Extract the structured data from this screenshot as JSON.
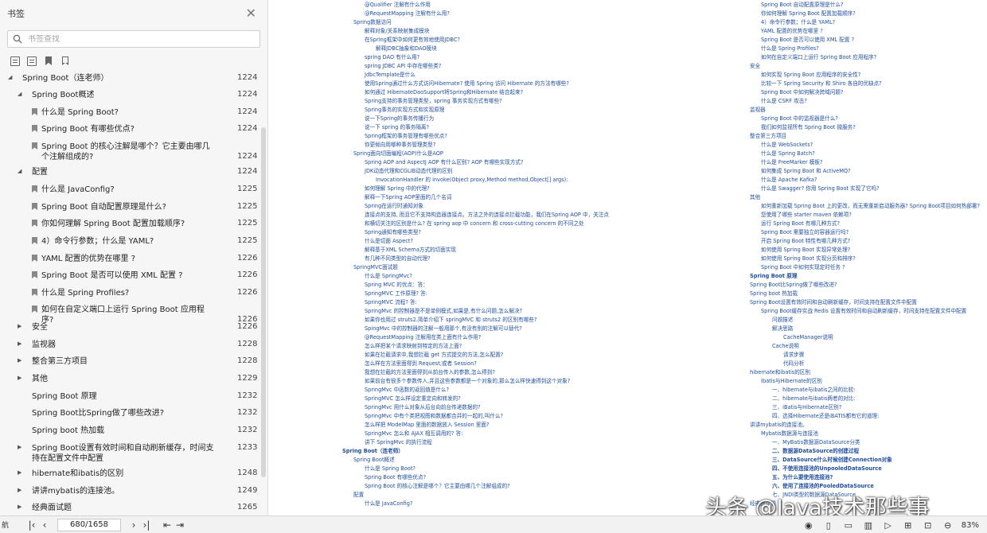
{
  "sidebar": {
    "title": "书签",
    "search_placeholder": "书签查找",
    "items": [
      {
        "label": "Spring Boot（连老师）",
        "page": "1224",
        "level": 0,
        "arrow": "open"
      },
      {
        "label": "Spring Boot概述",
        "page": "1224",
        "level": 1,
        "arrow": "open"
      },
      {
        "label": "什么是 Spring Boot?",
        "page": "1224",
        "level": 2,
        "arrow": "none"
      },
      {
        "label": "Spring Boot 有哪些优点?",
        "page": "1224",
        "level": 2,
        "arrow": "none"
      },
      {
        "label": "Spring Boot 的核心注解是哪个？它主要由哪几个注解组成的?",
        "page": "1224",
        "level": 2,
        "arrow": "none"
      },
      {
        "label": "配置",
        "page": "1224",
        "level": 1,
        "arrow": "open"
      },
      {
        "label": "什么是 JavaConfig?",
        "page": "1225",
        "level": 2,
        "arrow": "none"
      },
      {
        "label": "Spring Boot 自动配置原理是什么?",
        "page": "1225",
        "level": 2,
        "arrow": "none"
      },
      {
        "label": "你如何理解 Spring Boot 配置加载顺序?",
        "page": "1225",
        "level": 2,
        "arrow": "none"
      },
      {
        "label": "4）命令行参数；什么是 YAML?",
        "page": "1225",
        "level": 2,
        "arrow": "none"
      },
      {
        "label": "YAML 配置的优势在哪里 ?",
        "page": "1226",
        "level": 2,
        "arrow": "none"
      },
      {
        "label": "Spring Boot 是否可以使用 XML 配置 ?",
        "page": "1226",
        "level": 2,
        "arrow": "none"
      },
      {
        "label": "什么是 Spring Profiles?",
        "page": "1226",
        "level": 2,
        "arrow": "none"
      },
      {
        "label": "如何在自定义端口上运行 Spring Boot 应用程序?",
        "page": "1226",
        "level": 2,
        "arrow": "none"
      },
      {
        "label": "安全",
        "page": "1226",
        "level": 1,
        "arrow": "closed"
      },
      {
        "label": "监视器",
        "page": "1228",
        "level": 1,
        "arrow": "closed"
      },
      {
        "label": "整合第三方项目",
        "page": "1228",
        "level": 1,
        "arrow": "closed"
      },
      {
        "label": "其他",
        "page": "1229",
        "level": 1,
        "arrow": "closed"
      },
      {
        "label": "Spring Boot 原理",
        "page": "1232",
        "level": 1,
        "arrow": "none"
      },
      {
        "label": "Spring Boot比Spring做了哪些改进?",
        "page": "1232",
        "level": 1,
        "arrow": "none"
      },
      {
        "label": "Spring boot 热加载",
        "page": "1232",
        "level": 1,
        "arrow": "none"
      },
      {
        "label": "Spring Boot设置有效时间和自动刷新缓存，时间支持在配置文件中配置",
        "page": "1233",
        "level": 1,
        "arrow": "closed"
      },
      {
        "label": "hibernate和ibatis的区别",
        "page": "1248",
        "level": 1,
        "arrow": "closed"
      },
      {
        "label": "讲讲mybatis的连接池。",
        "page": "1249",
        "level": 1,
        "arrow": "closed"
      },
      {
        "label": "经典面试题",
        "page": "1265",
        "level": 1,
        "arrow": "closed"
      }
    ]
  },
  "document": {
    "left_column": [
      {
        "t": "@Qualifier 注解有什么作用",
        "lvl": 2,
        "b": false
      },
      {
        "t": "@RequestMapping 注解有什么用?",
        "lvl": 2,
        "b": false
      },
      {
        "t": "Spring数据访问",
        "lvl": 1,
        "b": false
      },
      {
        "t": "解释对象/关系映射集成模块",
        "lvl": 2,
        "b": false
      },
      {
        "t": "在Spring框架中如何更有效地使用JDBC?",
        "lvl": 2,
        "b": false
      },
      {
        "t": "解释JDBC抽象和DAO模块",
        "lvl": 3,
        "b": false
      },
      {
        "t": "spring DAO 有什么用?",
        "lvl": 2,
        "b": false
      },
      {
        "t": "spring JDBC API 中存在哪些类?",
        "lvl": 2,
        "b": false
      },
      {
        "t": "JdbcTemplate是什么",
        "lvl": 2,
        "b": false
      },
      {
        "t": "使用Spring通过什么方式访问Hibernate? 使用 Spring 访问 Hibernate 的方法有哪些?",
        "lvl": 2,
        "b": false
      },
      {
        "t": "如何通过 HibernateDaoSupport将Spring和Hibernate 结合起来?",
        "lvl": 2,
        "b": false
      },
      {
        "t": "Spring支持的事务管理类型，spring 事务实现方式有哪些?",
        "lvl": 2,
        "b": false
      },
      {
        "t": "Spring事务的实现方式和实现原理",
        "lvl": 2,
        "b": false
      },
      {
        "t": "说一下Spring的事务传播行为",
        "lvl": 2,
        "b": false
      },
      {
        "t": "说一下 spring 的事务隔离?",
        "lvl": 2,
        "b": false
      },
      {
        "t": "Spring框架的事务管理有哪些优点?",
        "lvl": 2,
        "b": false
      },
      {
        "t": "你更倾向用哪种事务管理类型?",
        "lvl": 2,
        "b": false
      },
      {
        "t": "Spring面向切面编程(AOP)什么是AOP",
        "lvl": 1,
        "b": false
      },
      {
        "t": "Spring AOP and AspectJ AOP 有什么区别? AOP 有哪些实现方式?",
        "lvl": 2,
        "b": false
      },
      {
        "t": "JDK动态代理和CGLIB动态代理的区别",
        "lvl": 2,
        "b": false
      },
      {
        "t": "InvocationHandler 的 invoke(Object proxy,Method method,Object[] args):",
        "lvl": 3,
        "b": false
      },
      {
        "t": "如何理解 Spring 中的代理?",
        "lvl": 2,
        "b": false
      },
      {
        "t": "解释一下Spring AOP里面的几个名词",
        "lvl": 2,
        "b": false
      },
      {
        "t": "Spring在运行时通知对象",
        "lvl": 2,
        "b": false
      },
      {
        "t": "连接点的支持, 而且它不支持构造器连接点。方法之外的连接点拦截功能，我们在Spring AOP 中，关注点",
        "lvl": 2,
        "b": false
      },
      {
        "t": "和横切关注的区别是什么? 在 spring aop 中 concern 和 cross-cutting concern 的不同之处",
        "lvl": 2,
        "b": false
      },
      {
        "t": "Spring通知有哪些类型?",
        "lvl": 2,
        "b": false
      },
      {
        "t": "什么是切面 Aspect?",
        "lvl": 2,
        "b": false
      },
      {
        "t": "解释基于XML Schema方式的切面实现",
        "lvl": 2,
        "b": false
      },
      {
        "t": "有几种不同类型的自动代理?",
        "lvl": 2,
        "b": false
      },
      {
        "t": "SpringMVC面试题",
        "lvl": 1,
        "b": false
      },
      {
        "t": "什么是 SpringMvc?",
        "lvl": 2,
        "b": false
      },
      {
        "t": "Spring MVC 的优点：答：",
        "lvl": 2,
        "b": false
      },
      {
        "t": "SpringMVC 工作原理? 答:",
        "lvl": 2,
        "b": false
      },
      {
        "t": "SpringMVC 流程? 答:",
        "lvl": 2,
        "b": false
      },
      {
        "t": "SpringMvc 的控制器是不是单例模式,如果是,有什么问题,怎么解决?",
        "lvl": 2,
        "b": false
      },
      {
        "t": "如果你也用过 struts2.简单介绍下 springMVC 和 struts2 的区别有哪些?",
        "lvl": 2,
        "b": false
      },
      {
        "t": "SpingMvc 中的控制器的注解一般用那个,有没有别的注解可以替代?",
        "lvl": 2,
        "b": false
      },
      {
        "t": "@RequestMapping 注解用在类上面有什么作用?",
        "lvl": 2,
        "b": false
      },
      {
        "t": "怎么样把某个请求映射到特定的方法上面?",
        "lvl": 2,
        "b": false
      },
      {
        "t": "如果在拦截请求中,我想拦截 get 方式提交的方法,怎么配置?",
        "lvl": 2,
        "b": false
      },
      {
        "t": "怎么样在方法里面得到 Request,或者 Session?",
        "lvl": 2,
        "b": false
      },
      {
        "t": "我想在拦截的方法里面得到从前台传入的参数,怎么得到?",
        "lvl": 2,
        "b": false
      },
      {
        "t": "如果前台有很多个参数传入,并且这些参数都是一个对象的,那么怎么样快速得到这个对象?",
        "lvl": 2,
        "b": false
      },
      {
        "t": "SpringMvc 中函数的返回值是什么?",
        "lvl": 2,
        "b": false
      },
      {
        "t": "SpringMVC 怎么样设定重定向和转发的?",
        "lvl": 2,
        "b": false
      },
      {
        "t": "SpringMvc 用什么对象从后台向前台传递数据的?",
        "lvl": 2,
        "b": false
      },
      {
        "t": "SpringMvc 中有个类把视图和数据都合并的一起的,叫什么?",
        "lvl": 2,
        "b": false
      },
      {
        "t": "怎么样把 ModelMap 里面的数据放入 Session 里面?",
        "lvl": 2,
        "b": false
      },
      {
        "t": "SpringMvc 怎么和 AJAX 相互调用的? 答:",
        "lvl": 2,
        "b": false
      },
      {
        "t": "讲下 SpringMvc 的执行流程",
        "lvl": 2,
        "b": false
      },
      {
        "t": "Spring Boot（连老师）",
        "lvl": 0,
        "b": true
      },
      {
        "t": "Spring Boot概述",
        "lvl": 1,
        "b": false
      },
      {
        "t": "什么是 Spring Boot?",
        "lvl": 2,
        "b": false
      },
      {
        "t": "Spring Boot 有哪些优点?",
        "lvl": 2,
        "b": false
      },
      {
        "t": "Spring Boot 的核心注解是哪个？它主要由哪几个注解组成的?",
        "lvl": 2,
        "b": false
      },
      {
        "t": "配置",
        "lvl": 1,
        "b": false
      },
      {
        "t": "什么是 JavaConfig?",
        "lvl": 2,
        "b": false
      }
    ],
    "right_column": [
      {
        "t": "Spring Boot 自动配置原理是什么?",
        "lvl": 2,
        "b": false
      },
      {
        "t": "你如何理解 Spring Boot 配置加载顺序?",
        "lvl": 2,
        "b": false
      },
      {
        "t": "4）命令行参数；什么是 YAML?",
        "lvl": 2,
        "b": false
      },
      {
        "t": "YAML 配置的优势在哪里 ?",
        "lvl": 2,
        "b": false
      },
      {
        "t": "Spring Boot 是否可以使用 XML 配置 ?",
        "lvl": 2,
        "b": false
      },
      {
        "t": "什么是 Spring Profiles?",
        "lvl": 2,
        "b": false
      },
      {
        "t": "如何在自定义端口上运行 Spring Boot 应用程序?",
        "lvl": 2,
        "b": false
      },
      {
        "t": "安全",
        "lvl": 1,
        "b": false
      },
      {
        "t": "如何实现 Spring Boot 应用程序的安全性?",
        "lvl": 2,
        "b": false
      },
      {
        "t": "比较一下 Spring Security 和 Shiro 各自的优缺点?",
        "lvl": 2,
        "b": false
      },
      {
        "t": "Spring Boot 中如何解决跨域问题?",
        "lvl": 2,
        "b": false
      },
      {
        "t": "什么是 CSRF 攻击?",
        "lvl": 2,
        "b": false
      },
      {
        "t": "监视器",
        "lvl": 1,
        "b": false
      },
      {
        "t": "Spring Boot 中的监视器是什么?",
        "lvl": 2,
        "b": false
      },
      {
        "t": "我们如何监视所有 Spring Boot 微服务?",
        "lvl": 2,
        "b": false
      },
      {
        "t": "整合第三方项目",
        "lvl": 1,
        "b": false
      },
      {
        "t": "什么是 WebSockets?",
        "lvl": 2,
        "b": false
      },
      {
        "t": "什么是 Spring Batch?",
        "lvl": 2,
        "b": false
      },
      {
        "t": "什么是 FreeMarker 模板?",
        "lvl": 2,
        "b": false
      },
      {
        "t": "如何集成 Spring Boot 和 ActiveMQ?",
        "lvl": 2,
        "b": false
      },
      {
        "t": "什么是 Apache Kafka?",
        "lvl": 2,
        "b": false
      },
      {
        "t": "什么是 Swagger? 你用 Spring Boot 实现了它吗?",
        "lvl": 2,
        "b": false
      },
      {
        "t": "其他",
        "lvl": 1,
        "b": false
      },
      {
        "t": "如何重新加载 Spring Boot 上的更改，而无需重新启动服务器? Spring Boot项目如何热部署?",
        "lvl": 2,
        "b": false
      },
      {
        "t": "您使用了哪些 starter maven 依赖项?",
        "lvl": 2,
        "b": false
      },
      {
        "t": "运行 Spring Boot 有哪几种方式?",
        "lvl": 2,
        "b": false
      },
      {
        "t": "Spring Boot 需要独立的容器运行吗?",
        "lvl": 2,
        "b": false
      },
      {
        "t": "开启 Spring Boot 特性有哪几种方式?",
        "lvl": 2,
        "b": false
      },
      {
        "t": "如何使用 Spring Boot 实现异常处理?",
        "lvl": 2,
        "b": false
      },
      {
        "t": "如何使用 Spring Boot 实现分页和排序?",
        "lvl": 2,
        "b": false
      },
      {
        "t": "Spring Boot 中如何实现定时任务 ?",
        "lvl": 2,
        "b": false
      },
      {
        "t": "Spring Boot 原理",
        "lvl": 1,
        "b": true
      },
      {
        "t": "Spring Boot比Spring做了哪些改进?",
        "lvl": 1,
        "b": false
      },
      {
        "t": "Spring boot 热加载",
        "lvl": 1,
        "b": false
      },
      {
        "t": "Spring Boot设置有效时间和自动刷新缓存，时间支持在配置文件中配置",
        "lvl": 1,
        "b": false
      },
      {
        "t": "Spring Boot缓存实战 Redis 设置有效时间和自动刷新缓存，时间支持在配置文件中配置",
        "lvl": 2,
        "b": false
      },
      {
        "t": "问题描述",
        "lvl": 3,
        "b": false
      },
      {
        "t": "解决思路",
        "lvl": 3,
        "b": false
      },
      {
        "t": "CacheManager说明",
        "lvl": 4,
        "b": false
      },
      {
        "t": "Cache说明",
        "lvl": 3,
        "b": false
      },
      {
        "t": "请求步骤",
        "lvl": 4,
        "b": false
      },
      {
        "t": "代码分析",
        "lvl": 4,
        "b": false
      },
      {
        "t": "hibernate和ibatis的区别",
        "lvl": 1,
        "b": false
      },
      {
        "t": "Ibatis与Hibernate的区别",
        "lvl": 2,
        "b": false
      },
      {
        "t": "一、hibernate与ibatis之间的比较:",
        "lvl": 3,
        "b": false
      },
      {
        "t": "二、hibernate与ibatis两者的对比:",
        "lvl": 3,
        "b": false
      },
      {
        "t": "三、iBatis与Hibernate区别?",
        "lvl": 3,
        "b": false
      },
      {
        "t": "四、选择Hibernate还是iBATIS都有它的道理:",
        "lvl": 3,
        "b": false
      },
      {
        "t": "讲讲mybatis的连接池。",
        "lvl": 1,
        "b": false
      },
      {
        "t": "Mybatis数据源与连接池",
        "lvl": 2,
        "b": false
      },
      {
        "t": "一、MyBatis数据源DataSource分类",
        "lvl": 3,
        "b": false
      },
      {
        "t": "二、数据源DataSource的创建过程",
        "lvl": 3,
        "b": true
      },
      {
        "t": "三、DataSource什么时候创建Connection对象",
        "lvl": 3,
        "b": true
      },
      {
        "t": "四、不使用连接池的UnpooledDataSource",
        "lvl": 3,
        "b": true
      },
      {
        "t": "五、为什么要使用连接池?",
        "lvl": 3,
        "b": true
      },
      {
        "t": "六、使用了连接池的PooledDataSource",
        "lvl": 3,
        "b": true
      },
      {
        "t": "七、JNDI类型的数据源DataSource",
        "lvl": 3,
        "b": false
      },
      {
        "t": "经典面试题",
        "lvl": 1,
        "b": false
      }
    ],
    "watermark": "头条 @Java技术那些事"
  },
  "statusbar": {
    "nav_label": "航",
    "page_value": "680/1658",
    "zoom": "83%"
  },
  "colors": {
    "link": "#1f4e9e",
    "sidebar_bg": "#f6f6f6",
    "status_bg": "#f2f2f2"
  }
}
